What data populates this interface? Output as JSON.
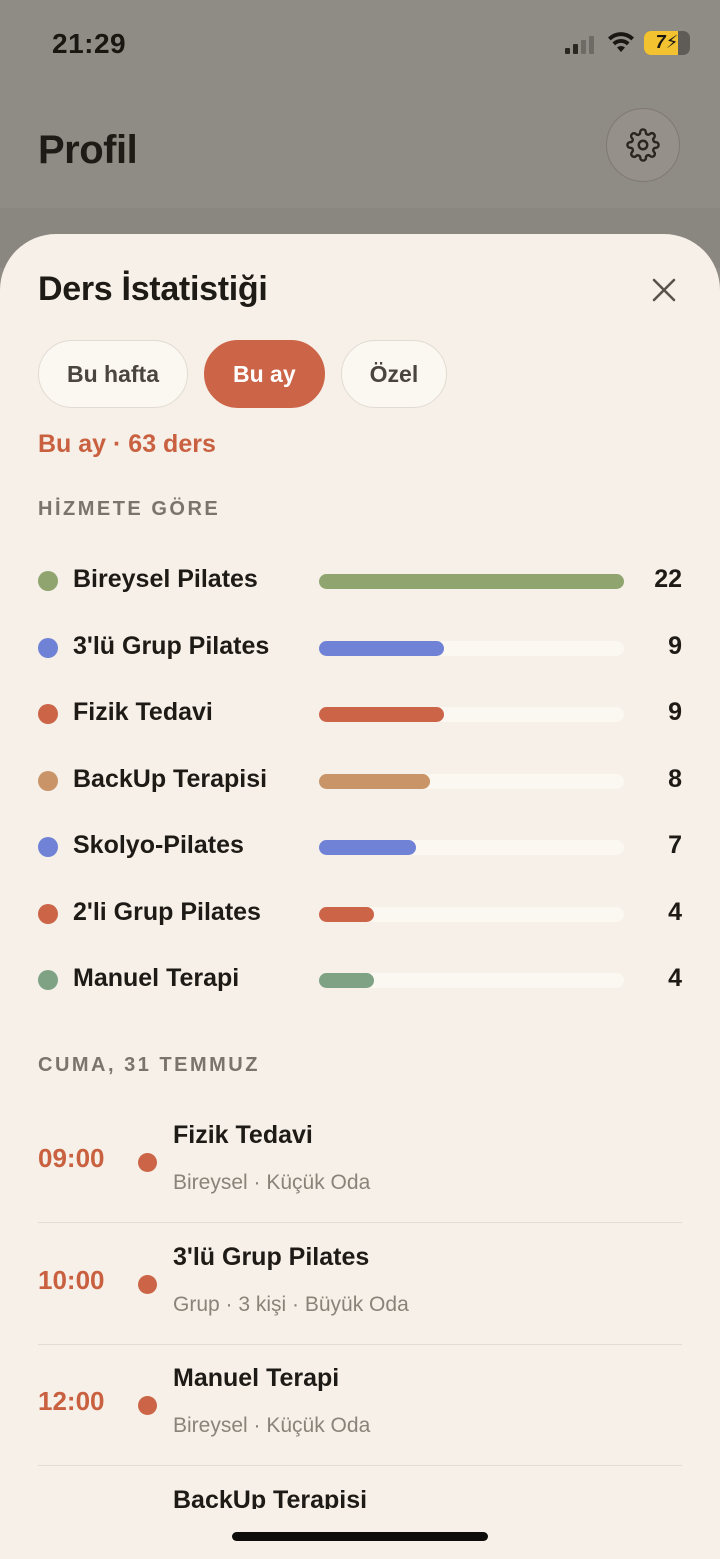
{
  "status_bar": {
    "time": "21:29",
    "battery_level": "74",
    "battery_label": "7",
    "icons": [
      "signal-icon",
      "wifi-icon",
      "battery-icon"
    ]
  },
  "background": {
    "title": "Profil",
    "settings_icon": "gear-icon"
  },
  "sheet": {
    "title": "Ders İstatistiği",
    "close_icon": "close-icon",
    "tabs": [
      {
        "label": "Bu hafta",
        "active": false
      },
      {
        "label": "Bu ay",
        "active": true
      },
      {
        "label": "Özel",
        "active": false
      }
    ],
    "summary": "Bu ay · 63 ders",
    "service_section_label": "HİZMETE GÖRE",
    "services": [
      {
        "name": "Bireysel Pilates",
        "count": "22",
        "value": 22,
        "color": "#8fa46e"
      },
      {
        "name": "3'lü Grup Pilates",
        "count": "9",
        "value": 9,
        "color": "#6f82d6"
      },
      {
        "name": "Fizik Tedavi",
        "count": "9",
        "value": 9,
        "color": "#cc6448"
      },
      {
        "name": "BackUp Terapisi",
        "count": "8",
        "value": 8,
        "color": "#c89468"
      },
      {
        "name": "Skolyo-Pilates",
        "count": "7",
        "value": 7,
        "color": "#6f82d6"
      },
      {
        "name": "2'li Grup Pilates",
        "count": "4",
        "value": 4,
        "color": "#cc6448"
      },
      {
        "name": "Manuel Terapi",
        "count": "4",
        "value": 4,
        "color": "#7fa285"
      }
    ],
    "max_value": 22,
    "day_section_label": "CUMA, 31 TEMMUZ",
    "sessions": [
      {
        "time": "09:00",
        "name": "Fizik Tedavi",
        "meta": "Bireysel · Küçük Oda"
      },
      {
        "time": "10:00",
        "name": "3'lü Grup Pilates",
        "meta": "Grup · 3 kişi · Büyük Oda"
      },
      {
        "time": "12:00",
        "name": "Manuel Terapi",
        "meta": "Bireysel · Küçük Oda"
      },
      {
        "time": "",
        "name": "BackUp Terapisi",
        "meta": ""
      }
    ]
  }
}
